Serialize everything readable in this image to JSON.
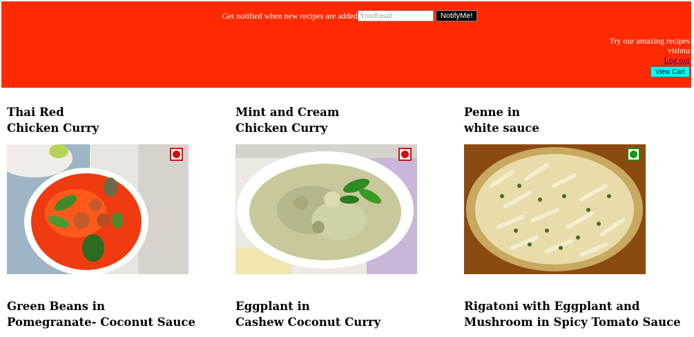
{
  "header": {
    "notify_text": "Get notified when new recipes are added",
    "email_placeholder": "YourEmail",
    "notify_button": "NotifyMe!",
    "tagline": "Try our amazing recipes",
    "username": "vishnu",
    "logout_link": "Log out",
    "cart_button": "View Cart",
    "background_color": "#ff2a00"
  },
  "recipes": [
    {
      "title_line1": "Thai Red",
      "title_line2": "Chicken Curry",
      "diet": "non-veg",
      "badge_icon": "non-veg-icon"
    },
    {
      "title_line1": "Mint and Cream",
      "title_line2": "Chicken Curry",
      "diet": "non-veg",
      "badge_icon": "non-veg-icon"
    },
    {
      "title_line1": "Penne in",
      "title_line2": "white sauce",
      "diet": "veg",
      "badge_icon": "veg-icon"
    },
    {
      "title_line1": "Green Beans in",
      "title_line2": "Pomegranate- Coconut Sauce"
    },
    {
      "title_line1": "Eggplant in",
      "title_line2": "Cashew Coconut Curry"
    },
    {
      "title_line1": "Rigatoni with Eggplant and",
      "title_line2": "Mushroom in Spicy Tomato Sauce"
    }
  ]
}
